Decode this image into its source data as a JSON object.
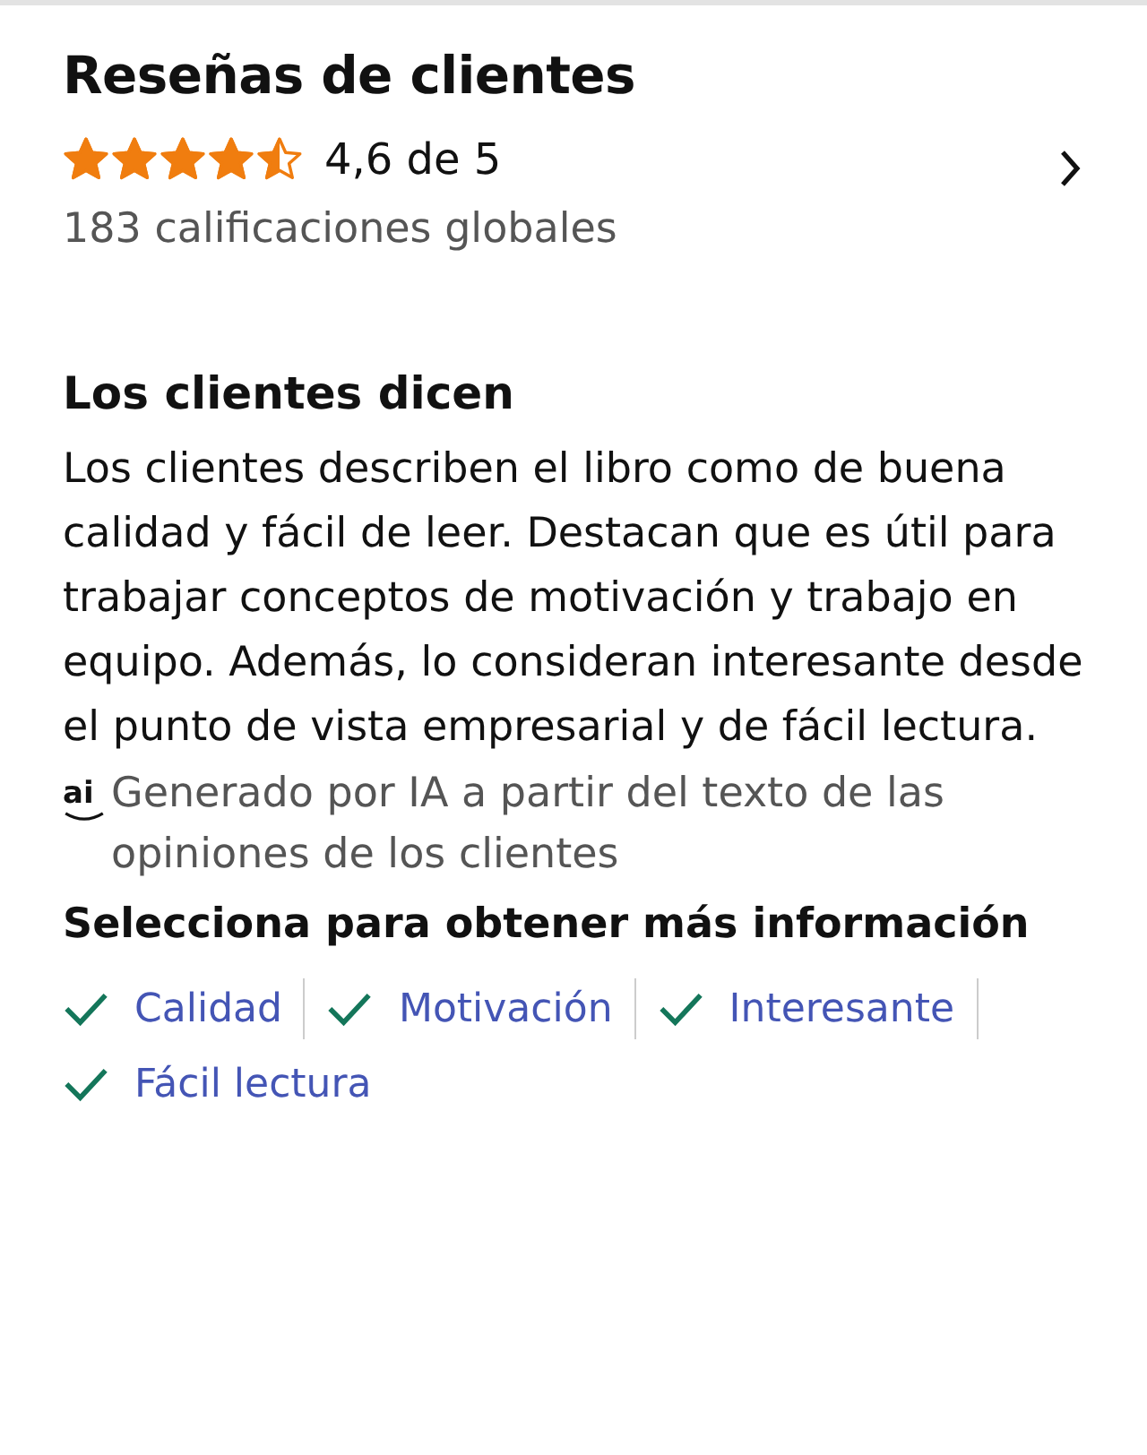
{
  "title": "Reseñas de clientes",
  "rating": {
    "stars": 4.5,
    "text": "4,6 de 5",
    "count": "183 calificaciones globales"
  },
  "summary": {
    "heading": "Los clientes dicen",
    "text": "Los clientes describen el libro como de buena calidad y fácil de leer. Destacan que es útil para trabajar conceptos de motivación y trabajo en equipo. Además, lo consideran interesante desde el punto de vista empresarial y de fácil lectura.",
    "ai_badge": "ai",
    "ai_note": "Generado por IA a partir del texto de las opiniones de los clientes"
  },
  "aspects": {
    "heading": "Selecciona para obtener más información",
    "items": [
      {
        "label": "Calidad"
      },
      {
        "label": "Motivación"
      },
      {
        "label": "Interesante"
      },
      {
        "label": "Fácil lectura"
      }
    ]
  }
}
